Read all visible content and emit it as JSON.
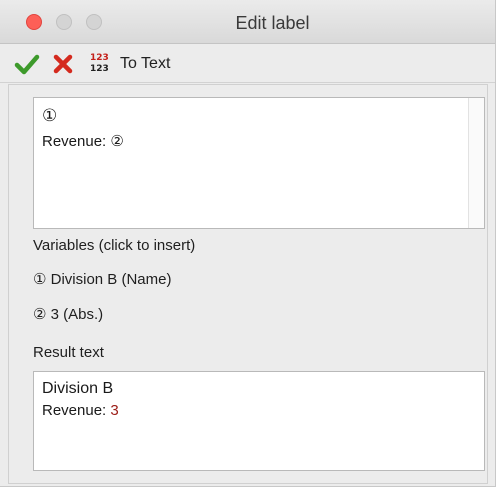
{
  "window": {
    "title": "Edit label"
  },
  "toolbar": {
    "ok_icon": "checkmark-icon",
    "cancel_icon": "x-icon",
    "totext_icon_top": "123",
    "totext_icon_bottom": "123",
    "totext_label": "To Text",
    "colors": {
      "ok": "#3d9a2b",
      "cancel": "#d42a1e"
    }
  },
  "editor": {
    "line1": "①",
    "line2_prefix": "Revenue: ",
    "line2_token": "②"
  },
  "variables": {
    "heading": "Variables (click to insert)",
    "items": [
      {
        "token": "①",
        "text": " Division B (Name)"
      },
      {
        "token": "②",
        "text": " 3 (Abs.)"
      }
    ]
  },
  "result": {
    "heading": "Result text",
    "line1_value": "Division B",
    "line2_prefix": "Revenue: ",
    "line2_value": "3",
    "value_color": "#9b1b15"
  }
}
